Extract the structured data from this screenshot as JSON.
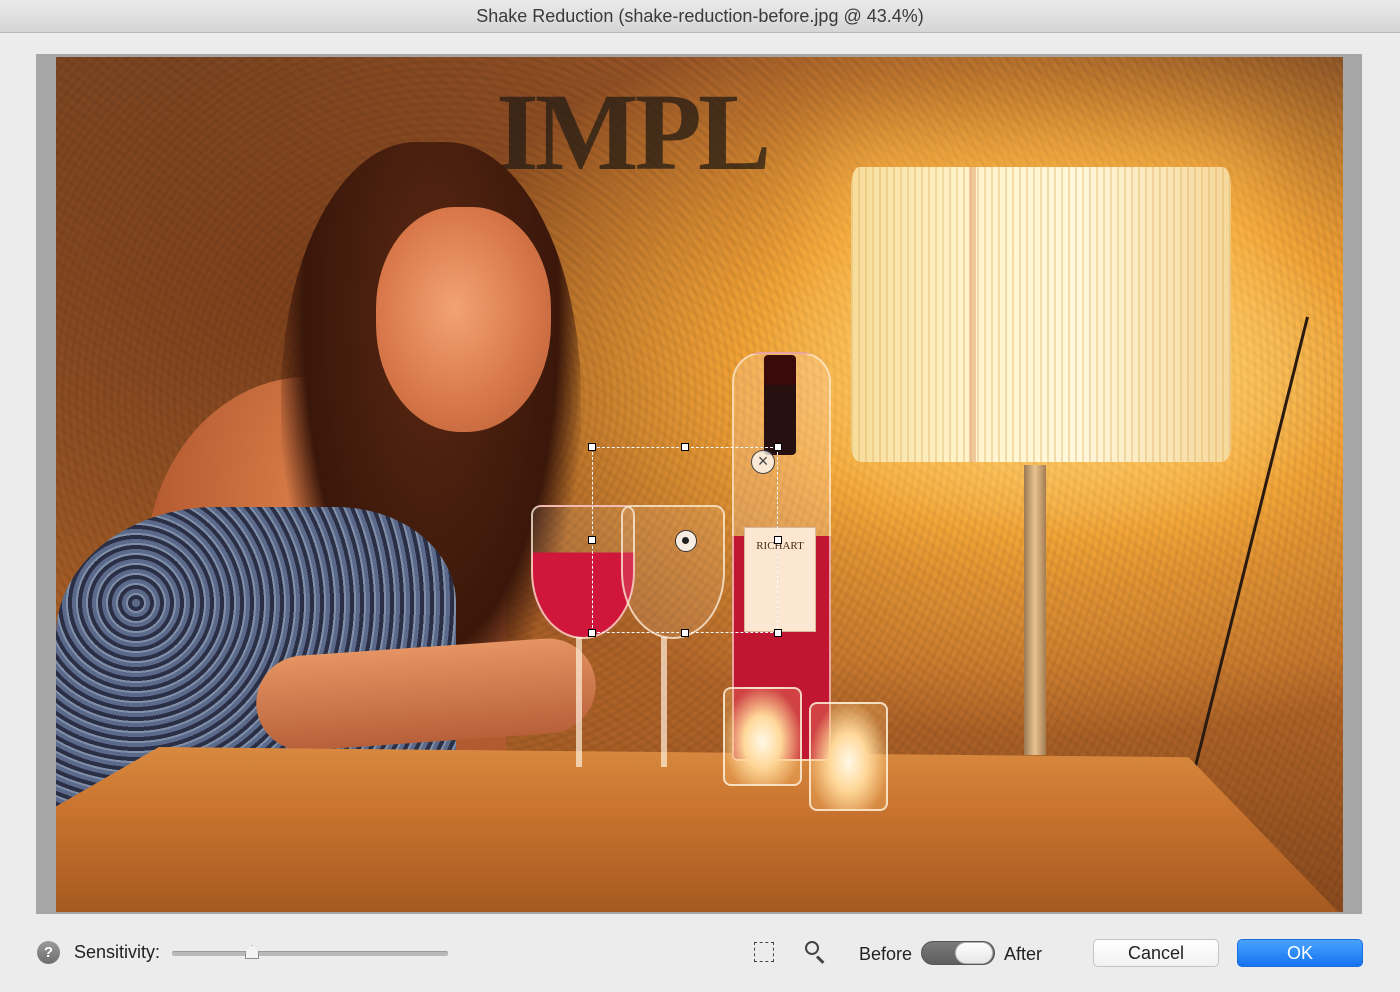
{
  "window": {
    "title": "Shake Reduction (shake-reduction-before.jpg @ 43.4%)"
  },
  "preview": {
    "wall_sign_text": "IMPL",
    "bottle_label_text": "RICHART",
    "region_close_glyph": "×"
  },
  "controls": {
    "help_glyph": "?",
    "sensitivity_label": "Sensitivity:",
    "sensitivity_value": 0.29,
    "before_label": "Before",
    "after_label": "After",
    "toggle_state": "after",
    "cancel_label": "Cancel",
    "ok_label": "OK"
  },
  "colors": {
    "accent": "#1473ef",
    "dialog_background": "#ececec"
  },
  "icons": {
    "help": "help-icon",
    "select_tool": "marquee-select-icon",
    "zoom_tool": "magnifier-icon",
    "region_close": "close-circle-icon",
    "region_center": "target-icon"
  }
}
